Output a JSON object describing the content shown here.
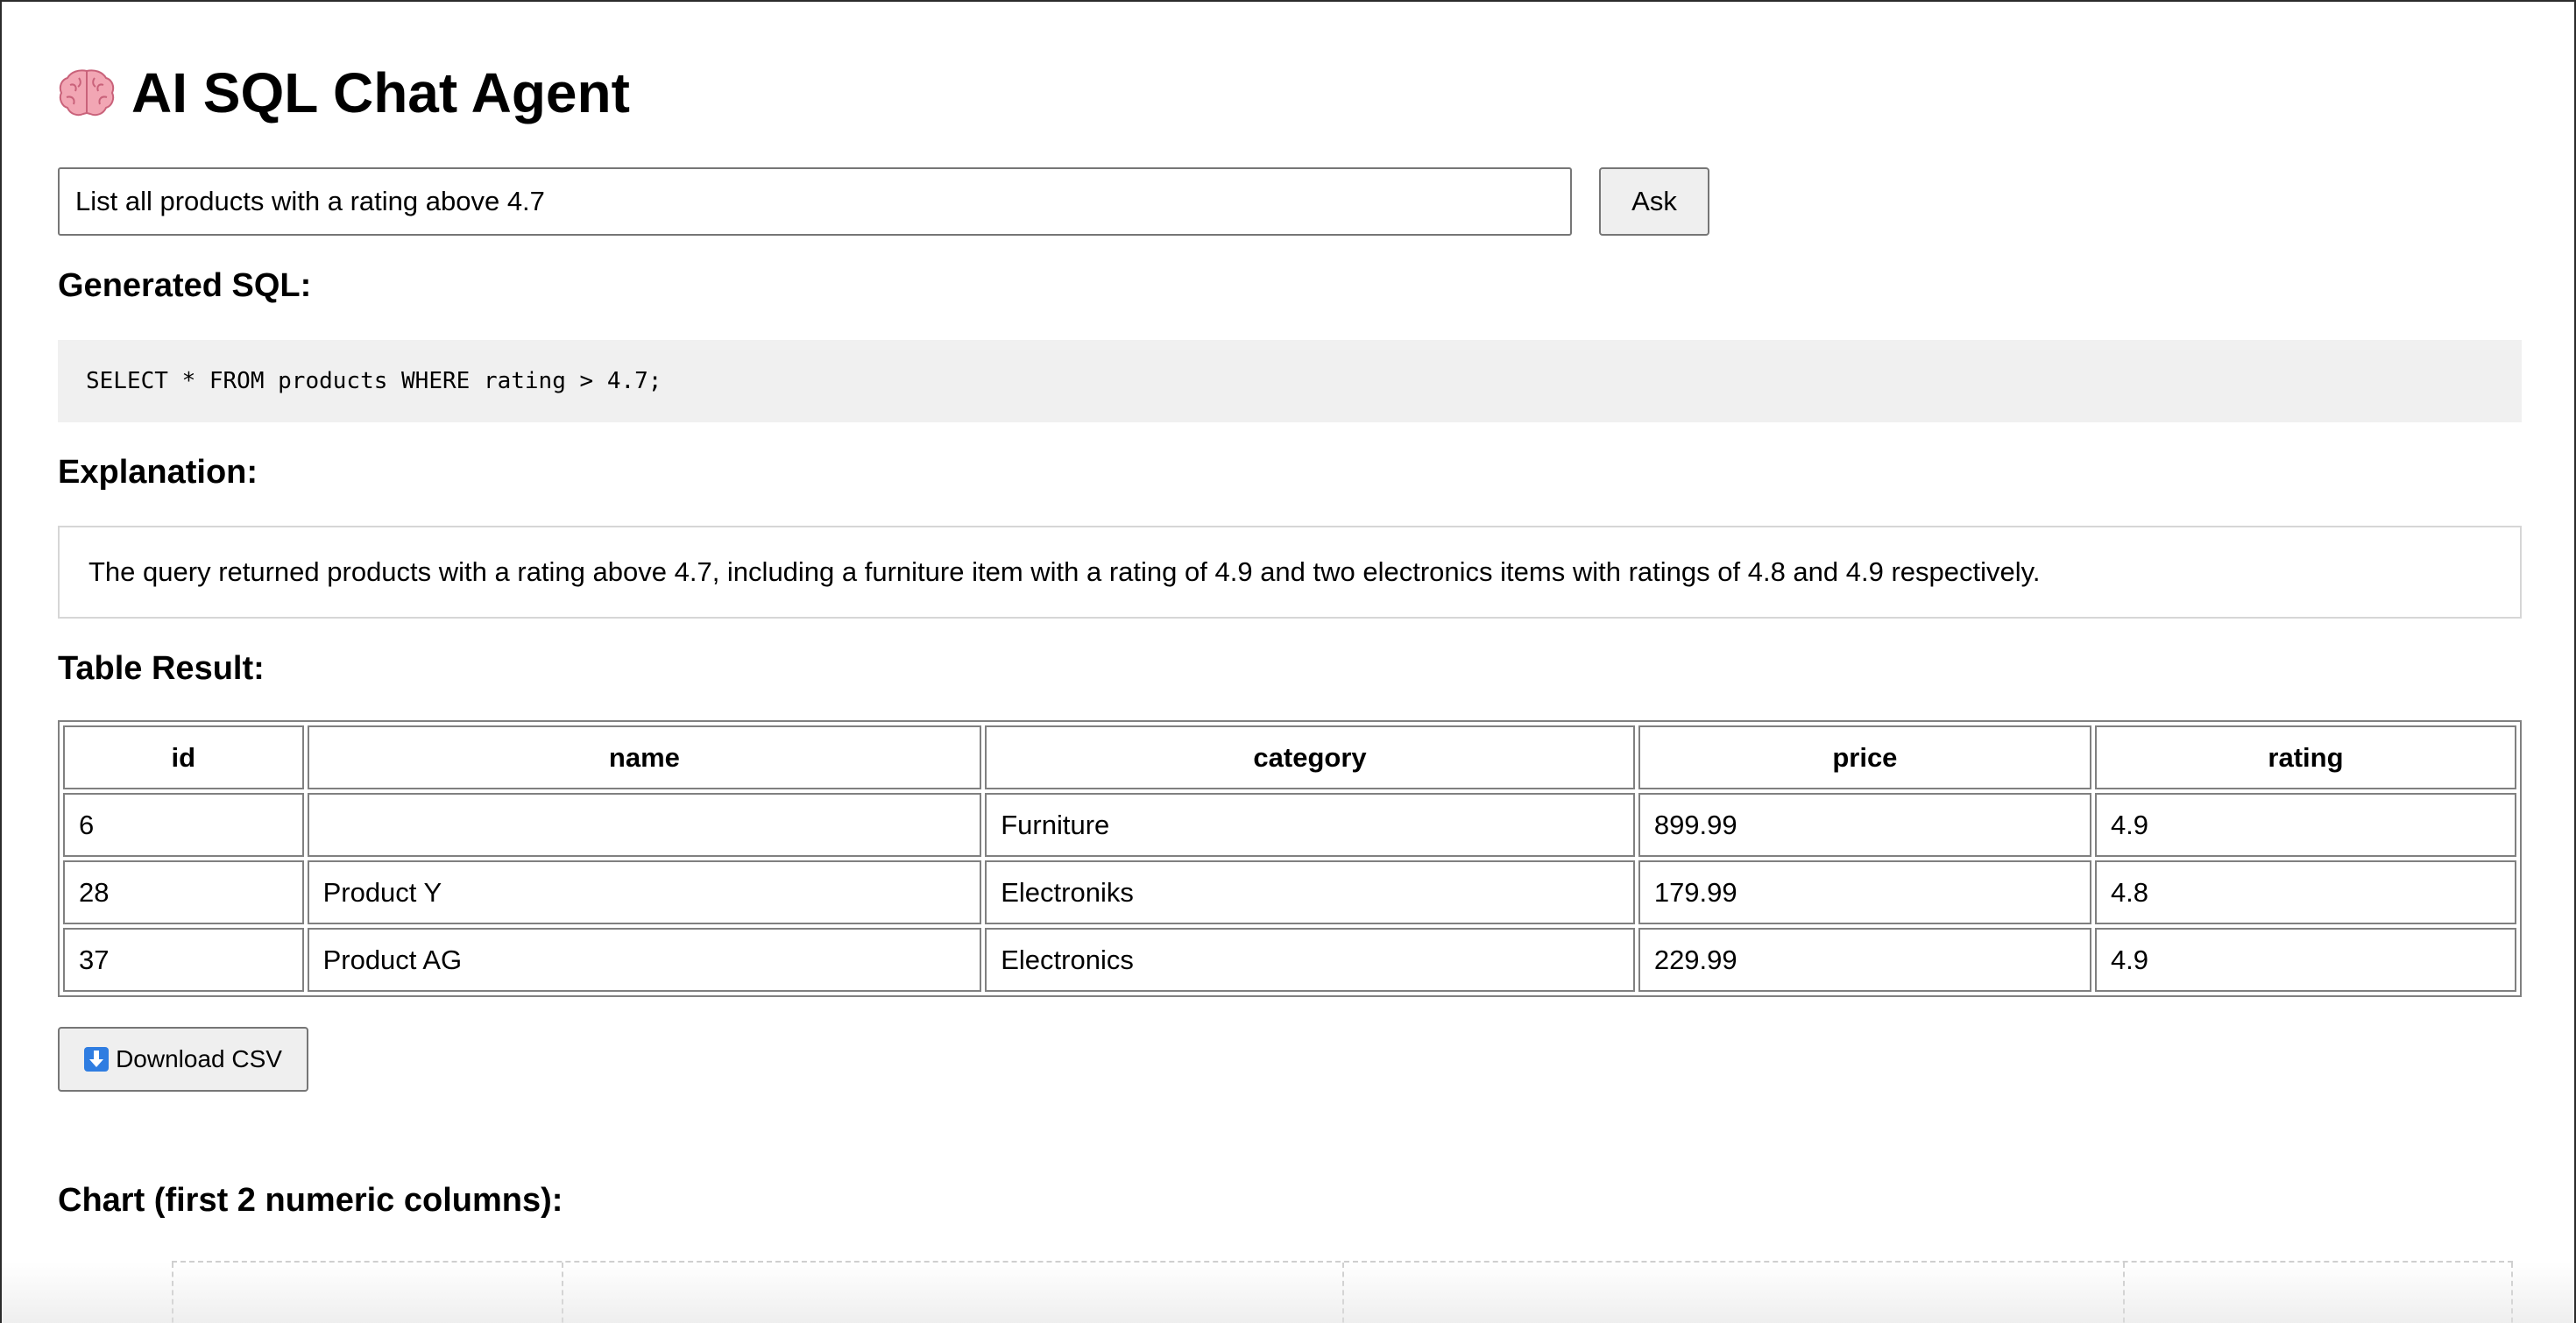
{
  "app": {
    "title": "AI SQL Chat Agent",
    "title_icon": "brain-icon"
  },
  "query": {
    "value": "List all products with a rating above 4.7",
    "ask_label": "Ask"
  },
  "sql_section": {
    "heading": "Generated SQL:",
    "sql": "SELECT * FROM products WHERE rating > 4.7;"
  },
  "explanation_section": {
    "heading": "Explanation:",
    "text": "The query returned products with a rating above 4.7, including a furniture item with a rating of 4.9 and two electronics items with ratings of 4.8 and 4.9 respectively."
  },
  "table_section": {
    "heading": "Table Result:",
    "columns": [
      "id",
      "name",
      "category",
      "price",
      "rating"
    ],
    "rows": [
      [
        "6",
        "",
        "Furniture",
        "899.99",
        "4.9"
      ],
      [
        "28",
        "Product Y",
        "Electroniks",
        "179.99",
        "4.8"
      ],
      [
        "37",
        "Product AG",
        "Electronics",
        "229.99",
        "4.9"
      ]
    ]
  },
  "download": {
    "label": "Download CSV",
    "icon": "download-arrow-icon"
  },
  "chart_section": {
    "heading": "Chart (first 2 numeric columns):"
  }
}
